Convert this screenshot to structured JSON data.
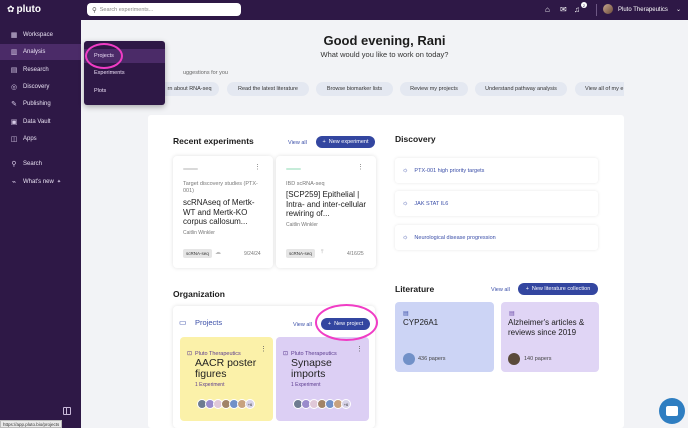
{
  "app": {
    "name": "pluto"
  },
  "sidebar": {
    "items": [
      {
        "label": "Workspace",
        "icon": "grid-icon"
      },
      {
        "label": "Analysis",
        "icon": "chart-icon"
      },
      {
        "label": "Research",
        "icon": "book-icon"
      },
      {
        "label": "Discovery",
        "icon": "compass-icon"
      },
      {
        "label": "Publishing",
        "icon": "pen-icon"
      },
      {
        "label": "Data Vault",
        "icon": "vault-icon"
      },
      {
        "label": "Apps",
        "icon": "apps-icon"
      },
      {
        "label": "Search",
        "icon": "search-icon"
      },
      {
        "label": "What's new",
        "icon": "rss-icon"
      }
    ]
  },
  "analysis_menu": {
    "items": [
      "Projects",
      "Experiments",
      "Plots"
    ]
  },
  "topbar": {
    "search_placeholder": "Search experiments...",
    "notification_count": "2",
    "org_name": "Pluto Therapeutics"
  },
  "home": {
    "greeting": "Good evening, Rani",
    "subgreeting": "What would you like to work on today?",
    "suggestions_label": "uggestions for you",
    "suggestions": [
      "rn about RNA-seq",
      "Read the latest literature",
      "Browse biomarker lists",
      "Review my projects",
      "Understand pathway analysis",
      "View all of my e"
    ]
  },
  "recent_experiments": {
    "title": "Recent experiments",
    "view_all": "View all",
    "new_button": "New experiment",
    "cards": [
      {
        "subtitle": "Target discovery studies (PTX-001)",
        "title": "scRNAseq of Mertk-WT and Mertk-KO corpus callosum...",
        "author": "Caitlin Winkler",
        "tag": "scRNA-seq",
        "date": "9/24/24",
        "color": "#d9d9d9"
      },
      {
        "subtitle": "IBD scRNA-seq",
        "title": "[SCP259] Epithelial | Intra- and inter-cellular rewiring of...",
        "author": "Caitlin Winkler",
        "tag": "scRNA-seq",
        "date": "4/16/25",
        "color": "#c6ecd9"
      }
    ]
  },
  "discovery": {
    "title": "Discovery",
    "items": [
      "PTX-001 high priority targets",
      "JAK STAT IL6",
      "Neurological disease progression"
    ]
  },
  "organization": {
    "title": "Organization",
    "projects_label": "Projects",
    "view_all": "View all",
    "new_button": "New project",
    "projects": [
      {
        "org": "Pluto Therapeutics",
        "title": "AACR poster figures",
        "count": "1 Experiment",
        "color": "#fbf1a9",
        "extra": "+6"
      },
      {
        "org": "Pluto Therapeutics",
        "title": "Synapse imports",
        "count": "1 Experiment",
        "color": "#dccff4",
        "extra": "+6"
      }
    ]
  },
  "literature": {
    "title": "Literature",
    "view_all": "View all",
    "new_button": "New literature collection",
    "cards": [
      {
        "title": "CYP26A1",
        "count": "436 papers",
        "color": "#ccd4f5"
      },
      {
        "title": "Alzheimer's articles & reviews since 2019",
        "count": "140 papers",
        "color": "#e0d5f5"
      }
    ]
  },
  "status_url": "https://app.pluto.bio/projects"
}
